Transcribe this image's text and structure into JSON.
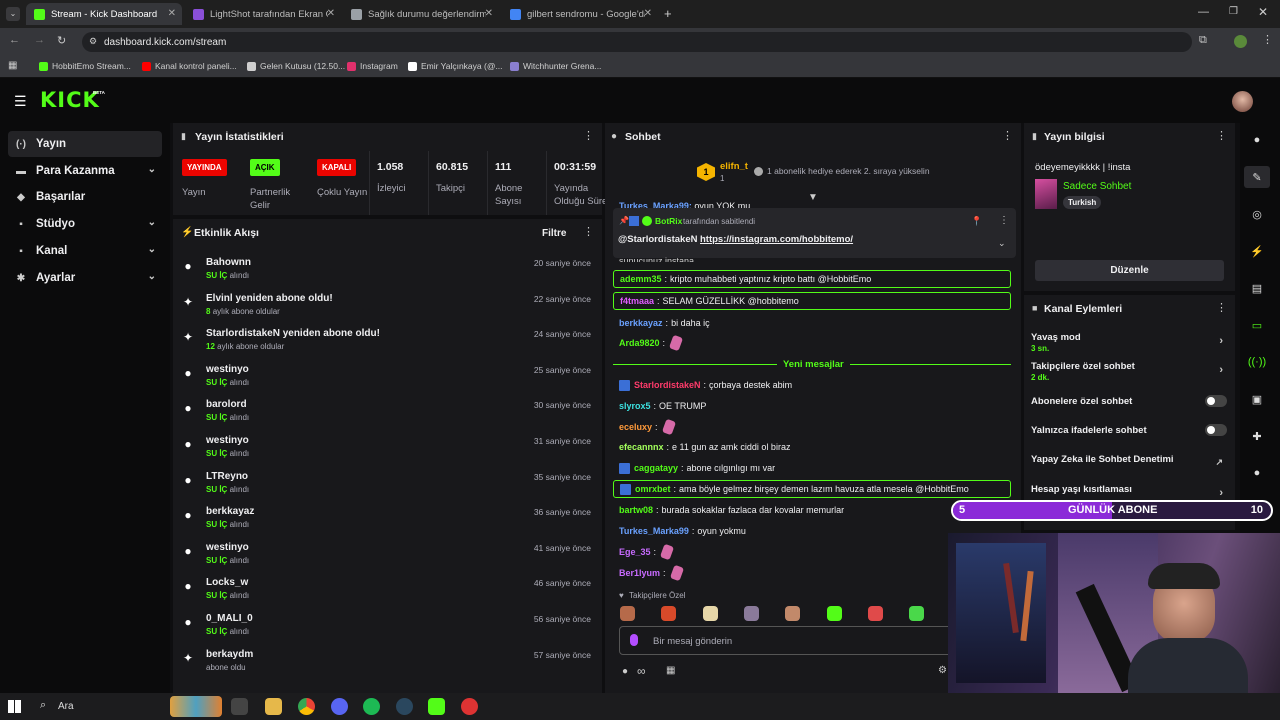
{
  "browser": {
    "tabs": [
      {
        "title": "Stream - Kick Dashboard",
        "color": "#53fc18"
      },
      {
        "title": "LightShot tarafından Ekran Gör",
        "color": "#8a4fd8"
      },
      {
        "title": "Sağlık durumu değerlendirmesi",
        "color": "#9aa0a6"
      },
      {
        "title": "gilbert sendromu - Google'da A",
        "color": "#4285f4"
      }
    ],
    "url": "dashboard.kick.com/stream",
    "bookmarks": [
      {
        "label": "HobbitEmo Stream...",
        "color": "#53fc18"
      },
      {
        "label": "Kanal kontrol paneli...",
        "color": "#ff0000"
      },
      {
        "label": "Gelen Kutusu (12.50...",
        "color": "#cfcfcf"
      },
      {
        "label": "Instagram",
        "color": "#e1306c"
      },
      {
        "label": "Emir Yalçınkaya (@...",
        "color": "#ffffff"
      },
      {
        "label": "Witchhunter Grena...",
        "color": "#8a7fd0"
      }
    ]
  },
  "nav": {
    "logo": "KICK",
    "logo_sup": "BETA",
    "items": [
      {
        "label": "Yayın",
        "icon": "broadcast-icon",
        "glyph": "(·)"
      },
      {
        "label": "Para Kazanma",
        "icon": "money-icon",
        "glyph": "▬"
      },
      {
        "label": "Başarılar",
        "icon": "trophy-icon",
        "glyph": "◆"
      },
      {
        "label": "Stüdyo",
        "icon": "studio-icon",
        "glyph": "▪"
      },
      {
        "label": "Kanal",
        "icon": "channel-icon",
        "glyph": "▪"
      },
      {
        "label": "Ayarlar",
        "icon": "gear-icon",
        "glyph": "✱"
      }
    ]
  },
  "stats": {
    "title": "Yayın İstatistikleri",
    "badges": [
      {
        "badge": "YAYINDA",
        "label": "Yayın",
        "bg": "#eb0400",
        "fg": "#ffffff"
      },
      {
        "badge": "AÇIK",
        "label": "Partnerlik Gelir",
        "bg": "#53fc18",
        "fg": "#000000"
      },
      {
        "badge": "KAPALI",
        "label": "Çoklu Yayın",
        "bg": "#eb0400",
        "fg": "#ffffff"
      }
    ],
    "values": [
      {
        "value": "1.058",
        "label": "İzleyici"
      },
      {
        "value": "60.815",
        "label": "Takipçi"
      },
      {
        "value": "111",
        "label": "Abone Sayısı"
      },
      {
        "value": "00:31:59",
        "label": "Yayında Olduğu Süre"
      }
    ]
  },
  "activity": {
    "title": "Etkinlik Akışı",
    "filter": "Filtre",
    "events": [
      {
        "icon": "follow-icon",
        "name": "Bahownn",
        "hl": "SU İÇ",
        "sub": "alındı",
        "time": "20 saniye önce"
      },
      {
        "icon": "sparkle-icon",
        "name": "Elvinl yeniden abone oldu!",
        "hl": "8",
        "sub": "aylık abone oldular",
        "time": "22 saniye önce"
      },
      {
        "icon": "sparkle-icon",
        "name": "StarlordistakeN yeniden abone oldu!",
        "hl": "12",
        "sub": "aylık abone oldular",
        "time": "24 saniye önce"
      },
      {
        "icon": "follow-icon",
        "name": "westinyo",
        "hl": "SU İÇ",
        "sub": "alındı",
        "time": "25 saniye önce"
      },
      {
        "icon": "follow-icon",
        "name": "barolord",
        "hl": "SU İÇ",
        "sub": "alındı",
        "time": "30 saniye önce"
      },
      {
        "icon": "follow-icon",
        "name": "westinyo",
        "hl": "SU İÇ",
        "sub": "alındı",
        "time": "31 saniye önce"
      },
      {
        "icon": "follow-icon",
        "name": "LTReyno",
        "hl": "SU İÇ",
        "sub": "alındı",
        "time": "35 saniye önce"
      },
      {
        "icon": "follow-icon",
        "name": "berkkayaz",
        "hl": "SU İÇ",
        "sub": "alındı",
        "time": "36 saniye önce"
      },
      {
        "icon": "follow-icon",
        "name": "westinyo",
        "hl": "SU İÇ",
        "sub": "alındı",
        "time": "41 saniye önce"
      },
      {
        "icon": "follow-icon",
        "name": "Locks_w",
        "hl": "SU İÇ",
        "sub": "alındı",
        "time": "46 saniye önce"
      },
      {
        "icon": "follow-icon",
        "name": "0_MALI_0",
        "hl": "SU İÇ",
        "sub": "alındı",
        "time": "56 saniye önce"
      },
      {
        "icon": "sparkle-icon",
        "name": "berkaydm",
        "hl": "",
        "sub": "abone oldu",
        "time": "57 saniye önce"
      }
    ]
  },
  "chat": {
    "title": "Sohbet",
    "leader": {
      "rank": "1",
      "name": "elifn_t",
      "count": "1",
      "text": "1 abonelik hediye ederek 2. sıraya yükselin"
    },
    "pinned": {
      "by": "BotRix",
      "by_suffix": "tarafından sabitlendi",
      "mention": "@StarlordistakeN",
      "link": "https://instagram.com/hobbitemo/"
    },
    "messages": [
      {
        "user": "ademm35",
        "color": "#53fc18",
        "text": "kripto muhabbeti yaptınız kripto battı @HobbitEmo",
        "hl": true,
        "badge": false,
        "emote": false
      },
      {
        "user": "f4tmaaa",
        "color": "#e05cff",
        "text": "SELAM GÜZELLİKK @hobbitemo",
        "hl": true,
        "badge": false,
        "emote": false
      },
      {
        "user": "berkkayaz",
        "color": "#6aa1ff",
        "text": "bi daha iç",
        "hl": false,
        "badge": false,
        "emote": false
      },
      {
        "user": "Arda9820",
        "color": "#53fc18",
        "text": "",
        "hl": false,
        "badge": false,
        "emote": true
      }
    ],
    "new_label": "Yeni mesajlar",
    "new_messages": [
      {
        "user": "StarlordistakeN",
        "color": "#ff3b6b",
        "text": "çorbaya destek abim",
        "hl": false,
        "badge": true,
        "emote": false
      },
      {
        "user": "slyrox5",
        "color": "#3ce0e0",
        "text": "OE TRUMP",
        "hl": false,
        "badge": false,
        "emote": false
      },
      {
        "user": "eceluxy",
        "color": "#ff9a3b",
        "text": "",
        "hl": false,
        "badge": false,
        "emote": true
      },
      {
        "user": "efecannnx",
        "color": "#a3ff5c",
        "text": "e 11 gun az amk ciddi ol biraz",
        "hl": false,
        "badge": false,
        "emote": false
      },
      {
        "user": "caggatayy",
        "color": "#53fc18",
        "text": "abone cılgınlıgı mı var",
        "hl": false,
        "badge": true,
        "emote": false
      },
      {
        "user": "omrxbet",
        "color": "#53fc18",
        "text": "ama böyle gelmez birşey demen lazım havuza atla mesela @HobbitEmo",
        "hl": true,
        "badge": true,
        "emote": false
      },
      {
        "user": "bartw08",
        "color": "#53fc18",
        "text": "burada sokaklar fazlaca dar kovalar memurlar",
        "hl": false,
        "badge": false,
        "emote": false
      },
      {
        "user": "Turkes_Marka99",
        "color": "#6aa1ff",
        "text": "oyun yokmu",
        "hl": false,
        "badge": false,
        "emote": false
      },
      {
        "user": "Ege_35",
        "color": "#c86bff",
        "text": "",
        "hl": false,
        "badge": false,
        "emote": true
      },
      {
        "user": "Ber1lyum",
        "color": "#c86bff",
        "text": "",
        "hl": false,
        "badge": false,
        "emote": true
      }
    ],
    "emote_label": "Takipçilere Özel",
    "placeholder": "Bir mesaj gönderin"
  },
  "info": {
    "title": "Yayın bilgisi",
    "stream_title": "ödeyemeyikkkk | !insta",
    "category": "Sadece Sohbet",
    "language": "Turkish",
    "edit": "Düzenle"
  },
  "actions": {
    "title": "Kanal Eylemleri",
    "items": [
      {
        "label": "Yavaş mod",
        "sub": "3 sn.",
        "kind": "chev"
      },
      {
        "label": "Takipçilere özel sohbet",
        "sub": "2 dk.",
        "kind": "chev"
      },
      {
        "label": "Abonelere özel sohbet",
        "sub": "",
        "kind": "toggle"
      },
      {
        "label": "Yalnızca ifadelerle sohbet",
        "sub": "",
        "kind": "toggle"
      },
      {
        "label": "Yapay Zeka ile Sohbet Denetimi",
        "sub": "",
        "kind": "ext"
      },
      {
        "label": "Hesap yaşı kısıtlaması",
        "sub": "",
        "kind": "chev"
      }
    ]
  },
  "sub_goal": {
    "left": "5",
    "label": "GÜNLÜK ABONE",
    "right": "10",
    "progress": 0.5
  },
  "taskbar": {
    "search": "Ara"
  }
}
